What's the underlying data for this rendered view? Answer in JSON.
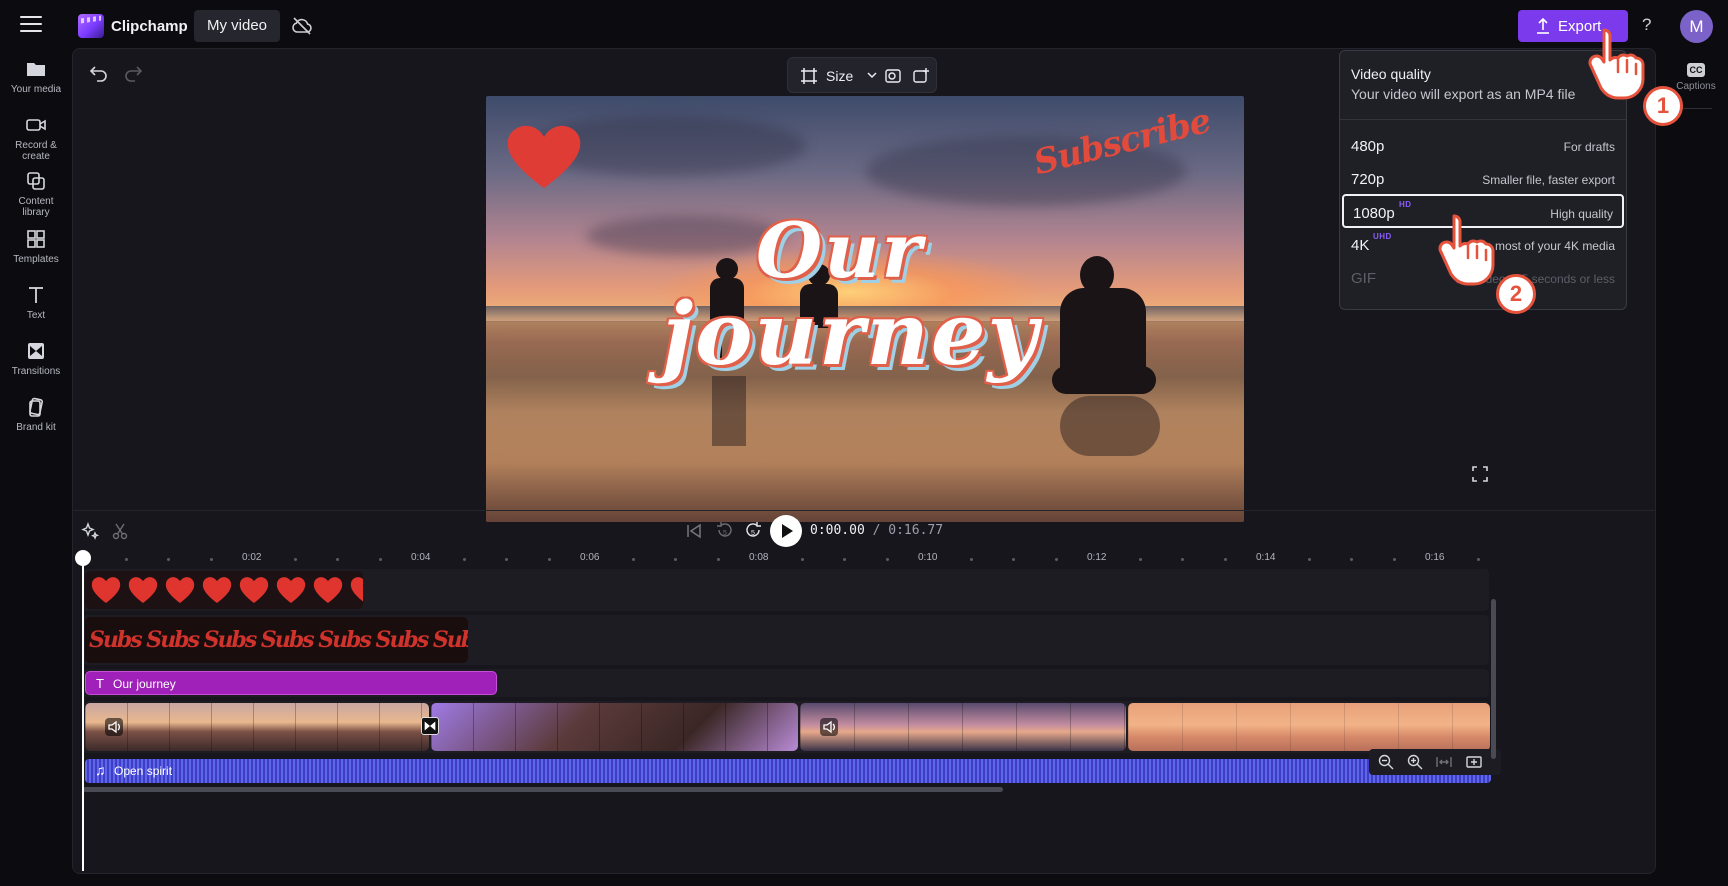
{
  "app": {
    "name": "Clipchamp",
    "project_name": "My video"
  },
  "topbar": {
    "export_label": "Export",
    "help_label": "?",
    "avatar_initial": "M"
  },
  "sidebar": {
    "items": [
      {
        "label": "Your media",
        "icon": "folder-icon"
      },
      {
        "label": "Record & create",
        "icon": "camera-icon"
      },
      {
        "label": "Content library",
        "icon": "content-library-icon"
      },
      {
        "label": "Templates",
        "icon": "templates-icon"
      },
      {
        "label": "Text",
        "icon": "text-icon"
      },
      {
        "label": "Transitions",
        "icon": "transitions-icon"
      },
      {
        "label": "Brand kit",
        "icon": "brand-kit-icon"
      }
    ]
  },
  "preview_toolbar": {
    "size_label": "Size"
  },
  "preview": {
    "title_line_1": "Our",
    "title_line_2": "journey",
    "sticker_text": "Subscribe"
  },
  "playback": {
    "current_time": "0:00.00",
    "duration": "/ 0:16.77"
  },
  "ruler": {
    "labels": [
      "0:02",
      "0:04",
      "0:06",
      "0:08",
      "0:10",
      "0:12",
      "0:14",
      "0:16"
    ]
  },
  "tracks": {
    "text_clip_label": "Our journey",
    "audio_clip_label": "Open spirit",
    "subscribe_clip_text": "Subs Subs Subs Subs Subs Subs Subs Subs Subs Subs"
  },
  "right_rail": {
    "captions_label": "Captions",
    "cc_text": "CC"
  },
  "export_menu": {
    "title": "Video quality",
    "subtitle": "Your video will export as an MP4 file",
    "options": [
      {
        "resolution": "480p",
        "badge": "",
        "description": "For drafts",
        "state": "normal"
      },
      {
        "resolution": "720p",
        "badge": "",
        "description": "Smaller file, faster export",
        "state": "normal"
      },
      {
        "resolution": "1080p",
        "badge": "HD",
        "description": "High quality",
        "state": "selected"
      },
      {
        "resolution": "4K",
        "badge": "UHD",
        "description": "Make the most of your 4K media",
        "state": "normal"
      },
      {
        "resolution": "GIF",
        "badge": "",
        "description": "For videos 15 seconds or less",
        "state": "disabled"
      }
    ]
  },
  "callouts": {
    "step_1": "1",
    "step_2": "2"
  },
  "colors": {
    "accent": "#7c3aed",
    "text_clip": "#a021b9",
    "audio_clip": "#3f3cc7",
    "callout": "#e5533d"
  }
}
